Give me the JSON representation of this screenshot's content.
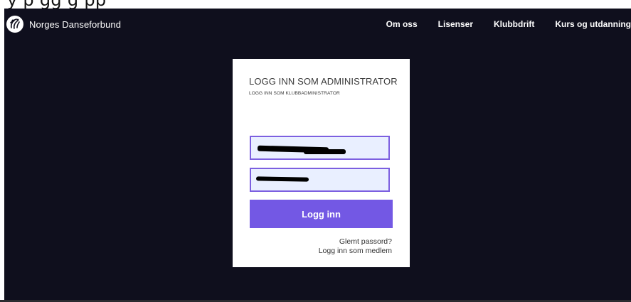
{
  "top_strip": {
    "text": "y               p   gg g             pp"
  },
  "header": {
    "brand_name": "Norges Danseforbund",
    "logo_icon": "dancers-logo-icon",
    "nav": [
      {
        "label": "Om oss"
      },
      {
        "label": "Lisenser"
      },
      {
        "label": "Klubbdrift"
      },
      {
        "label": "Kurs og utdanning"
      }
    ]
  },
  "login": {
    "title": "LOGG INN SOM ADMINISTRATOR",
    "subtitle": "LOGG INN SOM KLUBBADMINISTRATOR",
    "username_value": "",
    "password_value": "",
    "submit_label": "Logg inn",
    "forgot_password_label": "Glemt passord?",
    "member_login_label": "Logg inn som medlem"
  },
  "colors": {
    "background": "#0f0f1d",
    "accent": "#7358e4",
    "field_fill": "#e9efff",
    "field_border": "#7c5fe0"
  }
}
